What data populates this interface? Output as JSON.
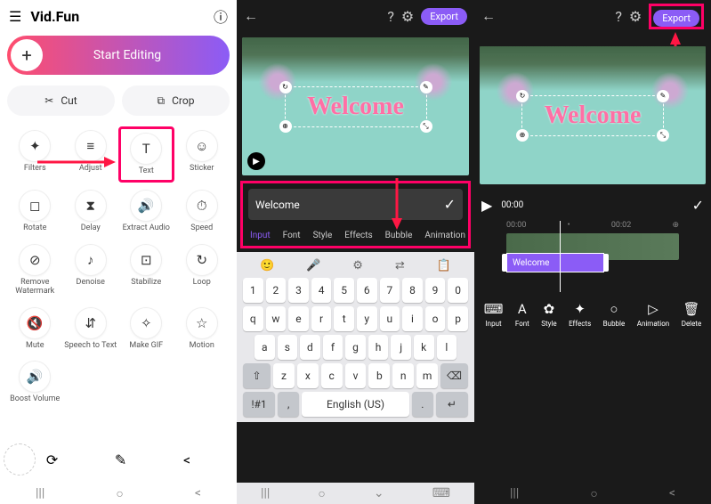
{
  "panel1": {
    "app_name": "Vid.Fun",
    "start_editing": "Start Editing",
    "cut": "Cut",
    "crop": "Crop",
    "tools": [
      {
        "label": "Filters",
        "icon": "✦"
      },
      {
        "label": "Adjust",
        "icon": "≡"
      },
      {
        "label": "Text",
        "icon": "T"
      },
      {
        "label": "Sticker",
        "icon": "☺"
      },
      {
        "label": "Rotate",
        "icon": "◻"
      },
      {
        "label": "Delay",
        "icon": "⧗"
      },
      {
        "label": "Extract Audio",
        "icon": "🔊"
      },
      {
        "label": "Speed",
        "icon": "⏱"
      },
      {
        "label": "Remove Watermark",
        "icon": "⊘"
      },
      {
        "label": "Denoise",
        "icon": "♪"
      },
      {
        "label": "Stabilize",
        "icon": "⊡"
      },
      {
        "label": "Loop",
        "icon": "↻"
      },
      {
        "label": "Mute",
        "icon": "🔇"
      },
      {
        "label": "Speech to Text",
        "icon": "⇵"
      },
      {
        "label": "Make GIF",
        "icon": "✧"
      },
      {
        "label": "Motion",
        "icon": "☆"
      },
      {
        "label": "Boost Volume",
        "icon": "🔊"
      }
    ]
  },
  "panel2": {
    "export": "Export",
    "welcome": "Welcome",
    "input_value": "Welcome",
    "tabs": [
      "Input",
      "Font",
      "Style",
      "Effects",
      "Bubble",
      "Animation"
    ],
    "keyboard": {
      "nums": [
        "1",
        "2",
        "3",
        "4",
        "5",
        "6",
        "7",
        "8",
        "9",
        "0"
      ],
      "row1": [
        "q",
        "w",
        "e",
        "r",
        "t",
        "y",
        "u",
        "i",
        "o",
        "p"
      ],
      "row2": [
        "a",
        "s",
        "d",
        "f",
        "g",
        "h",
        "j",
        "k",
        "l"
      ],
      "row3": [
        "z",
        "x",
        "c",
        "v",
        "b",
        "n",
        "m"
      ],
      "shift": "⇧",
      "backspace": "⌫",
      "sym": "!#1",
      "lang": "English (US)",
      "enter": "↵"
    }
  },
  "panel3": {
    "export": "Export",
    "welcome": "Welcome",
    "time_start": "00:00",
    "time_mid": "00:00",
    "time_end": "00:02",
    "clip_label": "Welcome",
    "tools": [
      {
        "label": "Input",
        "icon": "⌨"
      },
      {
        "label": "Font",
        "icon": "A"
      },
      {
        "label": "Style",
        "icon": "✿"
      },
      {
        "label": "Effects",
        "icon": "✦"
      },
      {
        "label": "Bubble",
        "icon": "○"
      },
      {
        "label": "Animation",
        "icon": "▷"
      },
      {
        "label": "Delete",
        "icon": "🗑"
      }
    ]
  }
}
